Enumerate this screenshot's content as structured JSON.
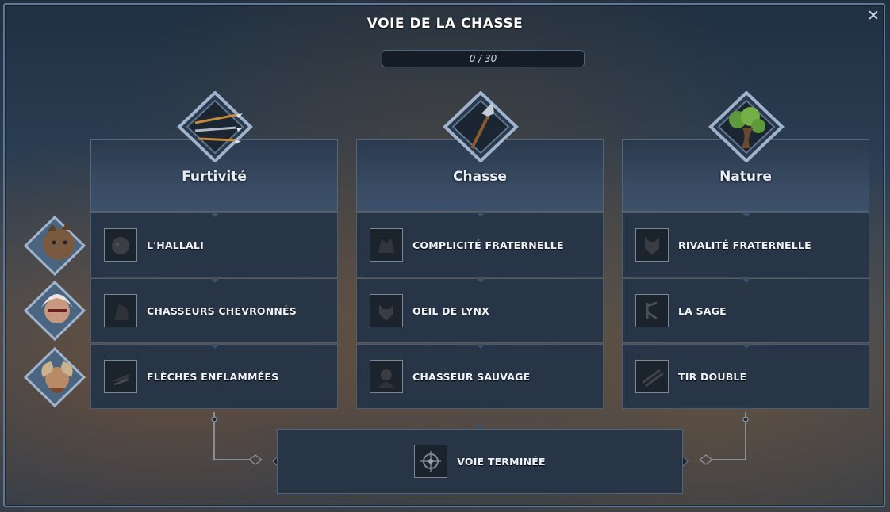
{
  "window": {
    "title": "VOIE DE LA CHASSE",
    "close_glyph": "✕",
    "progress_text": "0 / 30"
  },
  "columns": [
    {
      "title": "Furtivité",
      "emblem_icon": "arrows-icon",
      "rows": [
        {
          "label": "L'HALLALI",
          "icon": "beast-icon"
        },
        {
          "label": "CHASSEURS CHEVRONNÉS",
          "icon": "hunter-icon"
        },
        {
          "label": "FLÈCHES ENFLAMMÉES",
          "icon": "fire-arrow-icon"
        }
      ]
    },
    {
      "title": "Chasse",
      "emblem_icon": "spear-icon",
      "rows": [
        {
          "label": "COMPLICITÉ FRATERNELLE",
          "icon": "wolf-pair-icon"
        },
        {
          "label": "OEIL DE LYNX",
          "icon": "lynx-icon"
        },
        {
          "label": "CHASSEUR SAUVAGE",
          "icon": "wild-hunter-icon"
        }
      ]
    },
    {
      "title": "Nature",
      "emblem_icon": "tree-icon",
      "rows": [
        {
          "label": "RIVALITÉ FRATERNELLE",
          "icon": "cat-icon"
        },
        {
          "label": "LA SAGE",
          "icon": "rune-icon"
        },
        {
          "label": "TIR DOUBLE",
          "icon": "double-shot-icon"
        }
      ]
    }
  ],
  "portraits": [
    "lynx-hunter-portrait",
    "white-haired-woman-portrait",
    "ram-horned-hunter-portrait"
  ],
  "final": {
    "label": "VOIE TERMINÉE",
    "icon": "compass-emblem-icon"
  },
  "colors": {
    "accent": "#5f7896",
    "panel": "#283547",
    "header": "#3a4d65"
  }
}
